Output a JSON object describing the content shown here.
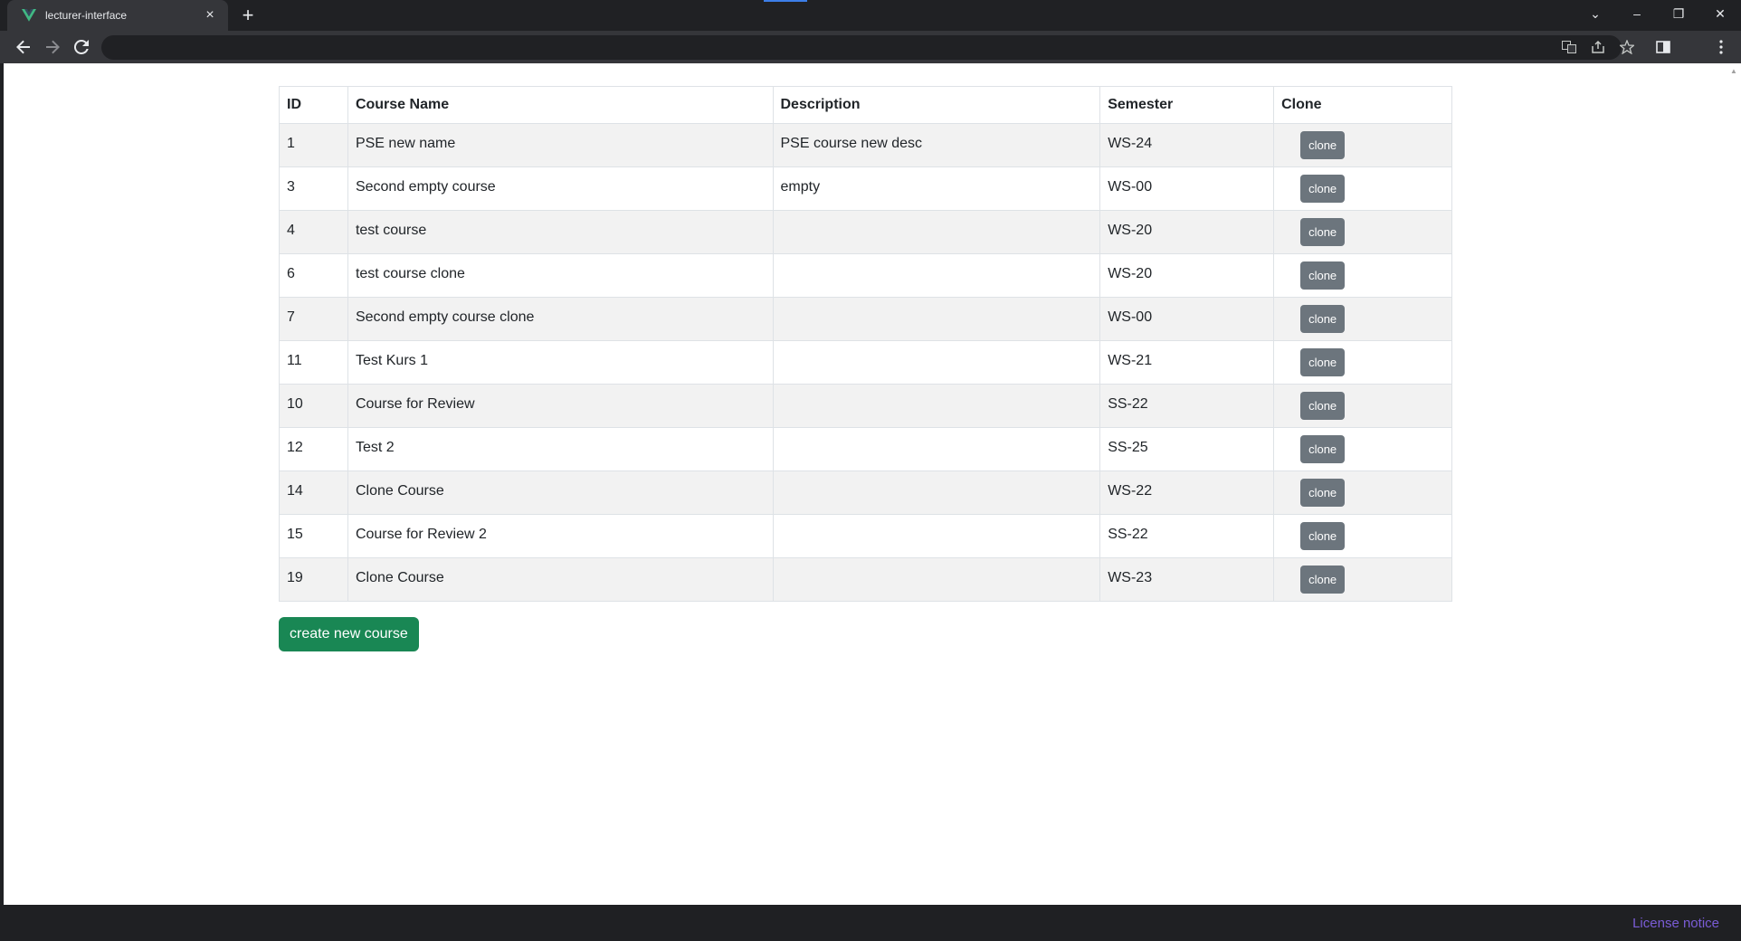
{
  "browser": {
    "tab_title": "lecturer-interface",
    "tab_close": "×",
    "new_tab": "+",
    "url": "",
    "win_controls": {
      "dropdown": "⌄",
      "minimize": "–",
      "restore": "❐",
      "close": "✕"
    }
  },
  "table": {
    "headers": {
      "id": "ID",
      "name": "Course Name",
      "description": "Description",
      "semester": "Semester",
      "clone": "Clone"
    },
    "rows": [
      {
        "id": "1",
        "name": "PSE new name",
        "description": "PSE course new desc",
        "semester": "WS-24",
        "clone_label": "clone"
      },
      {
        "id": "3",
        "name": "Second empty course",
        "description": "empty",
        "semester": "WS-00",
        "clone_label": "clone"
      },
      {
        "id": "4",
        "name": "test course",
        "description": "",
        "semester": "WS-20",
        "clone_label": "clone"
      },
      {
        "id": "6",
        "name": "test course clone",
        "description": "",
        "semester": "WS-20",
        "clone_label": "clone"
      },
      {
        "id": "7",
        "name": "Second empty course clone",
        "description": "",
        "semester": "WS-00",
        "clone_label": "clone"
      },
      {
        "id": "11",
        "name": "Test Kurs 1",
        "description": "",
        "semester": "WS-21",
        "clone_label": "clone"
      },
      {
        "id": "10",
        "name": "Course for Review",
        "description": "",
        "semester": "SS-22",
        "clone_label": "clone"
      },
      {
        "id": "12",
        "name": "Test 2",
        "description": "",
        "semester": "SS-25",
        "clone_label": "clone"
      },
      {
        "id": "14",
        "name": "Clone Course",
        "description": "",
        "semester": "WS-22",
        "clone_label": "clone"
      },
      {
        "id": "15",
        "name": "Course for Review 2",
        "description": "",
        "semester": "SS-22",
        "clone_label": "clone"
      },
      {
        "id": "19",
        "name": "Clone Course",
        "description": "",
        "semester": "WS-23",
        "clone_label": "clone"
      }
    ]
  },
  "actions": {
    "create_label": "create new course"
  },
  "footer": {
    "license_label": "License notice"
  },
  "colors": {
    "clone_button": "#6c757d",
    "create_button": "#198754",
    "license_link": "#7a5cd6",
    "striped_row": "#f2f2f2"
  }
}
